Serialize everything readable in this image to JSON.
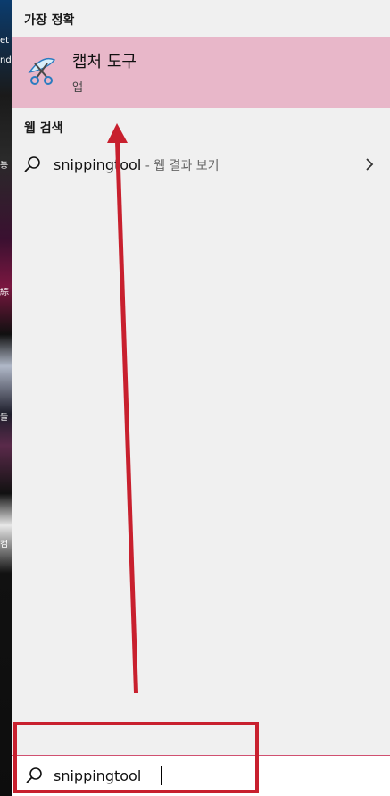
{
  "desktop": {
    "fragments": [
      "et",
      "nd",
      "통",
      "綜",
      "돌",
      "컴"
    ]
  },
  "search_pane": {
    "best_match": {
      "header": "가장 정확",
      "app_name": "캡처 도구",
      "app_type": "앱"
    },
    "web_search": {
      "header": "웹 검색",
      "query": "snippingtool",
      "hint": " - 웹 결과 보기"
    }
  },
  "search_box": {
    "value": "snippingtool"
  },
  "colors": {
    "highlight": "#e8b7c9",
    "annotation": "#c8202e",
    "pane_bg": "#f0f0f0"
  },
  "icons": {
    "app": "snipping-tool-scissors-icon",
    "search": "search-icon",
    "chevron": "chevron-right-icon"
  }
}
